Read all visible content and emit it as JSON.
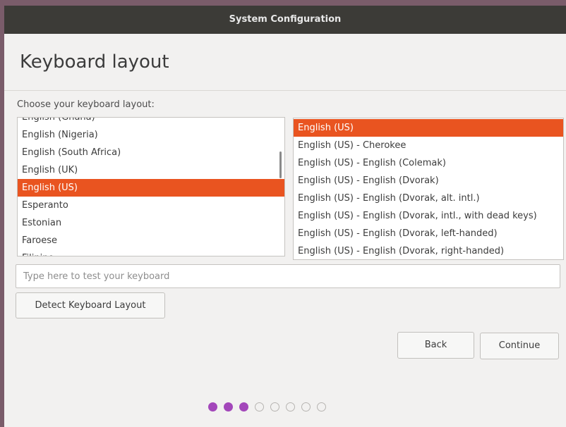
{
  "window": {
    "title": "System Configuration"
  },
  "page": {
    "title": "Keyboard layout",
    "choose_label": "Choose your keyboard layout:"
  },
  "layouts": {
    "items": [
      "English (Ghana)",
      "English (Nigeria)",
      "English (South Africa)",
      "English (UK)",
      "English (US)",
      "Esperanto",
      "Estonian",
      "Faroese",
      "Filipino"
    ],
    "selected": "English (US)"
  },
  "variants": {
    "items": [
      "English (US)",
      "English (US) - Cherokee",
      "English (US) - English (Colemak)",
      "English (US) - English (Dvorak)",
      "English (US) - English (Dvorak, alt. intl.)",
      "English (US) - English (Dvorak, intl., with dead keys)",
      "English (US) - English (Dvorak, left-handed)",
      "English (US) - English (Dvorak, right-handed)"
    ],
    "selected": "English (US)"
  },
  "test_input": {
    "placeholder": "Type here to test your keyboard",
    "value": ""
  },
  "buttons": {
    "detect": "Detect Keyboard Layout",
    "back": "Back",
    "continue": "Continue"
  },
  "progress": {
    "total_steps": 8,
    "completed_steps": 3
  },
  "colors": {
    "selection": "#e95420",
    "progress_active": "#a347ba",
    "titlebar": "#3c3b37"
  }
}
